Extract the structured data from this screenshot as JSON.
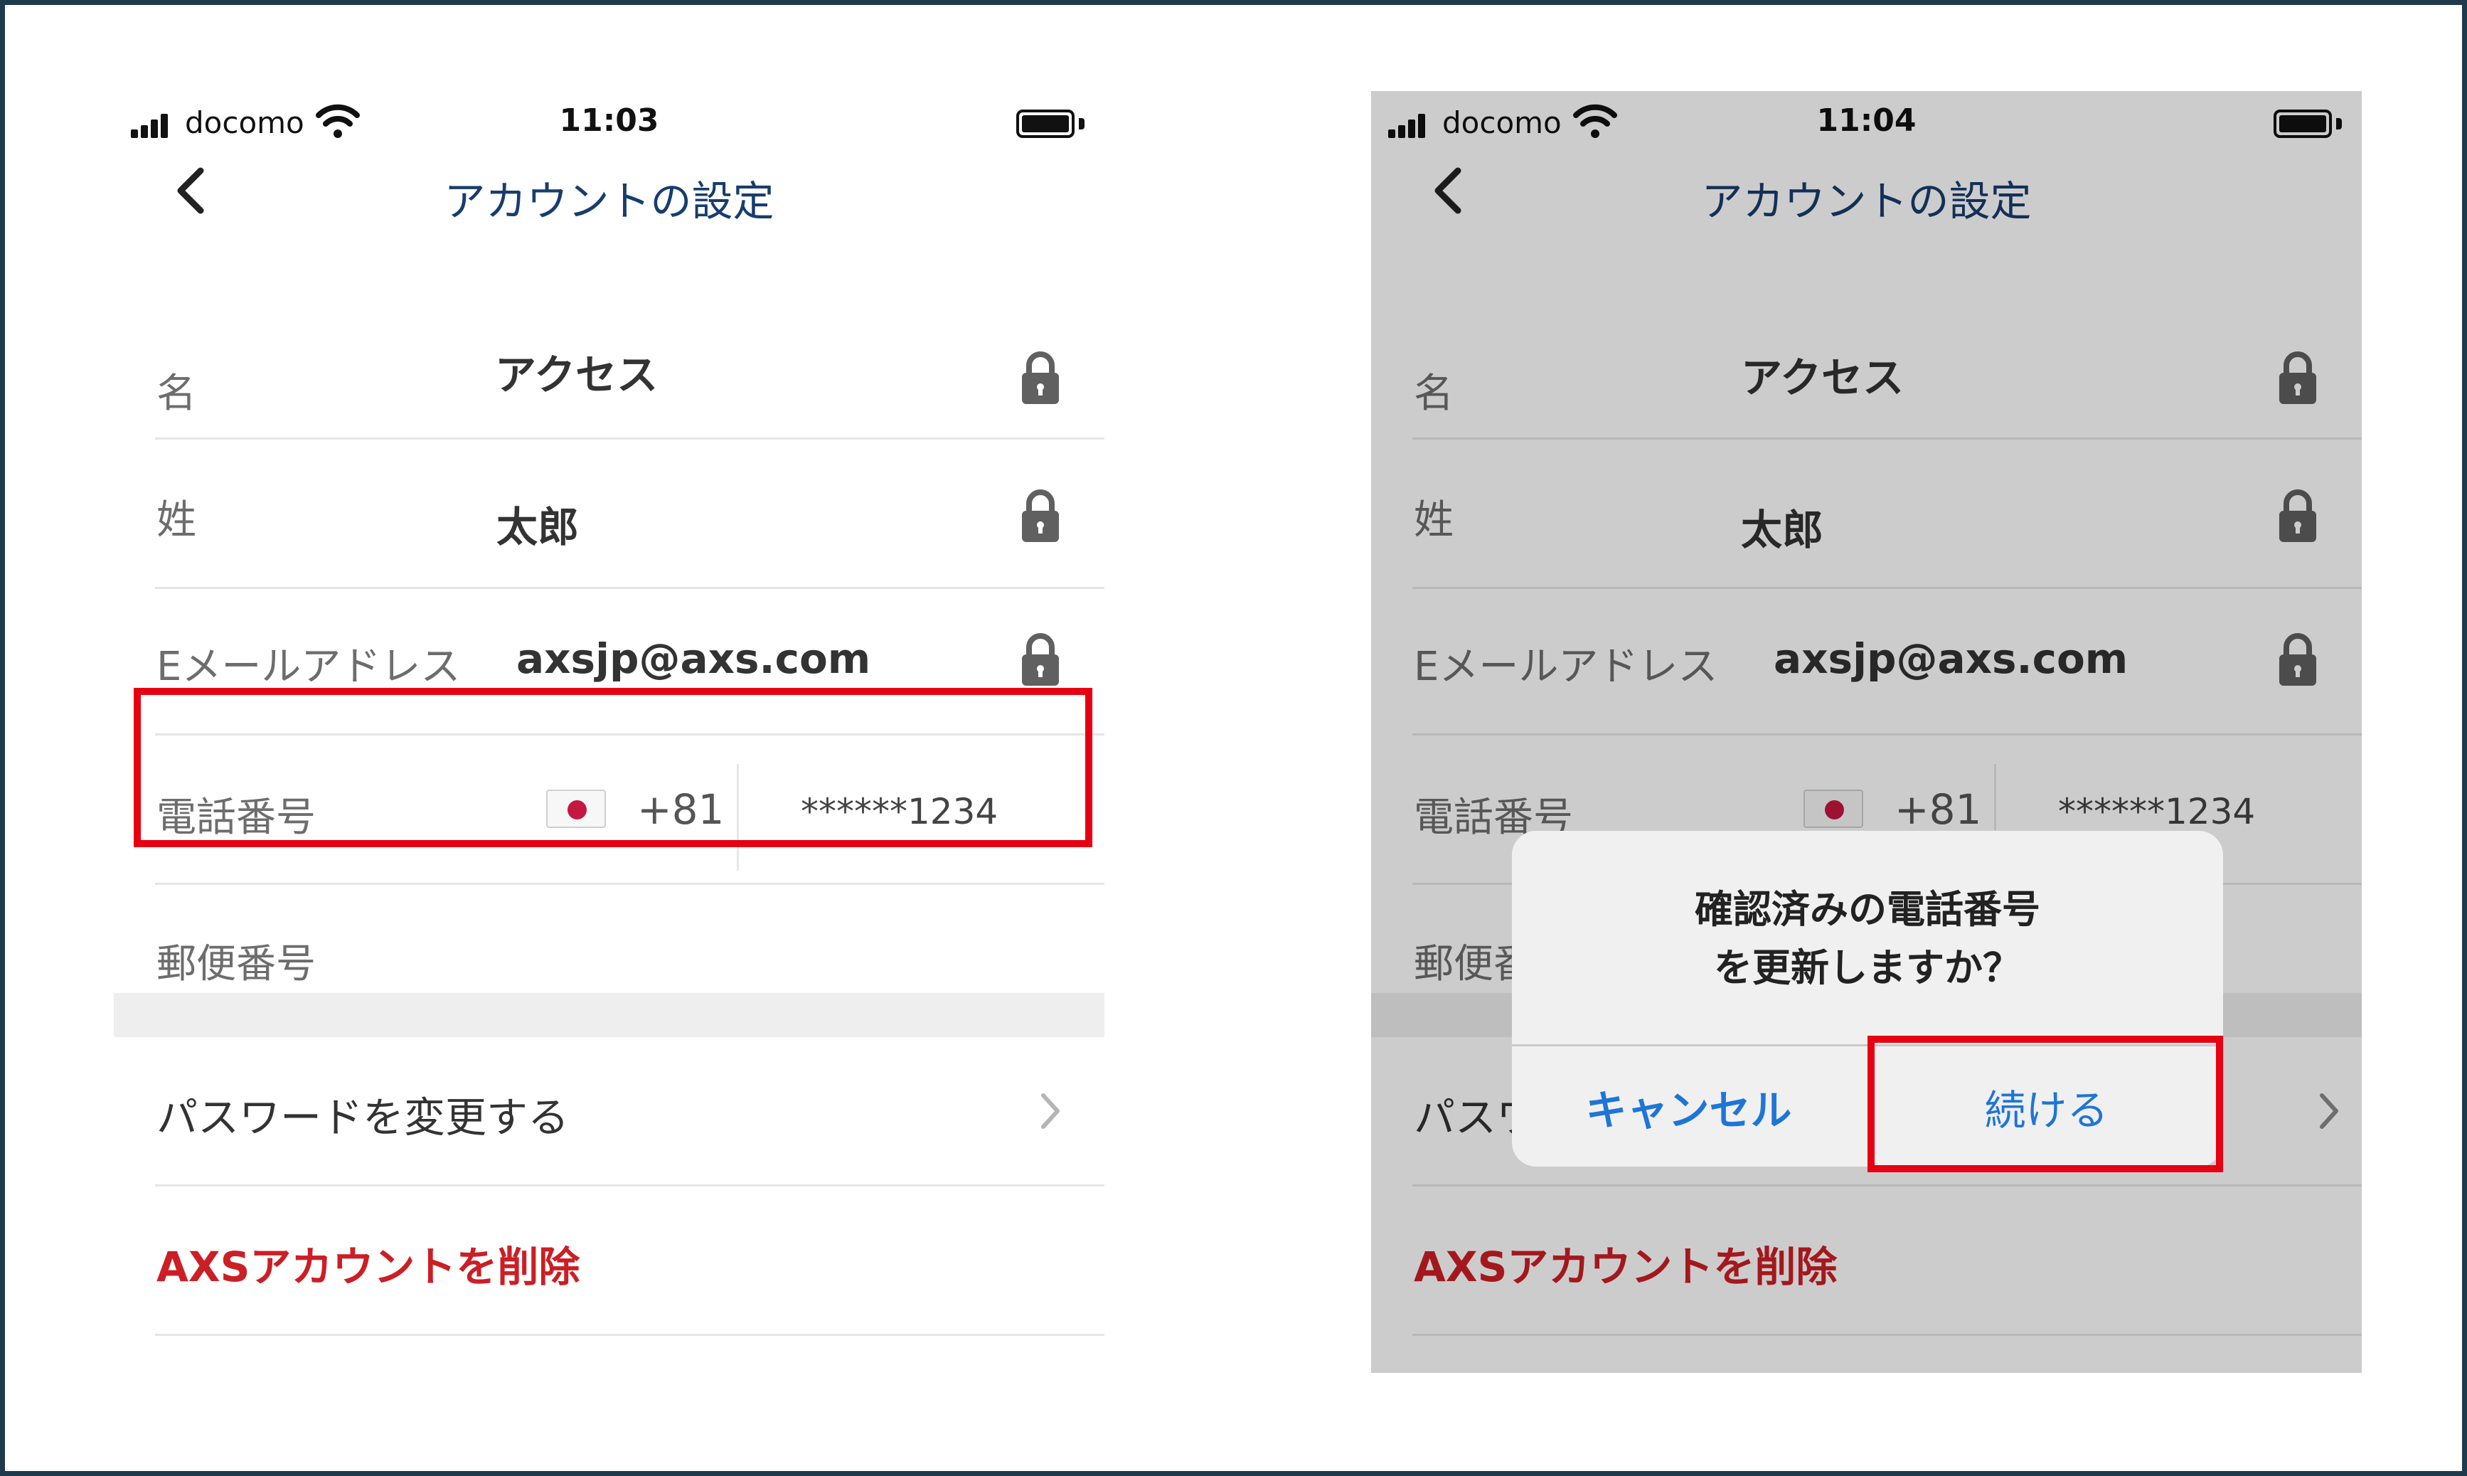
{
  "screens": [
    {
      "status_bar": {
        "carrier": "docomo",
        "time": "11:03"
      },
      "nav": {
        "title": "アカウントの設定"
      },
      "fields": {
        "first_name": {
          "label": "名",
          "value": "アクセス"
        },
        "last_name": {
          "label": "姓",
          "value": "太郎"
        },
        "email": {
          "label": "Eメールアドレス",
          "value": "axsjp@axs.com"
        },
        "phone": {
          "label": "電話番号",
          "country_code": "+81",
          "number": "******1234"
        },
        "postal": {
          "label": "郵便番号"
        }
      },
      "links": {
        "change_password": "パスワードを変更する",
        "delete_account": "AXSアカウントを削除"
      }
    },
    {
      "status_bar": {
        "carrier": "docomo",
        "time": "11:04"
      },
      "nav": {
        "title": "アカウントの設定"
      },
      "fields": {
        "first_name": {
          "label": "名",
          "value": "アクセス"
        },
        "last_name": {
          "label": "姓",
          "value": "太郎"
        },
        "email": {
          "label": "Eメールアドレス",
          "value": "axsjp@axs.com"
        },
        "phone": {
          "label": "電話番号",
          "country_code": "+81",
          "number": "******1234"
        },
        "postal": {
          "label": "郵便番号"
        }
      },
      "links": {
        "change_password": "パスワードを変更する",
        "delete_account": "AXSアカウントを削除"
      },
      "dialog": {
        "title_line1": "確認済みの電話番号",
        "title_line2": "を更新しますか？",
        "cancel": "キャンセル",
        "continue": "続ける"
      }
    }
  ],
  "colors": {
    "title": "#173d6d",
    "danger": "#cc1e25",
    "highlight": "#e60012",
    "dialog_button": "#1e75d6"
  },
  "icons": [
    "signal-icon",
    "wifi-icon",
    "battery-icon",
    "back-chevron-icon",
    "lock-icon",
    "japan-flag-icon",
    "chevron-right-icon"
  ]
}
